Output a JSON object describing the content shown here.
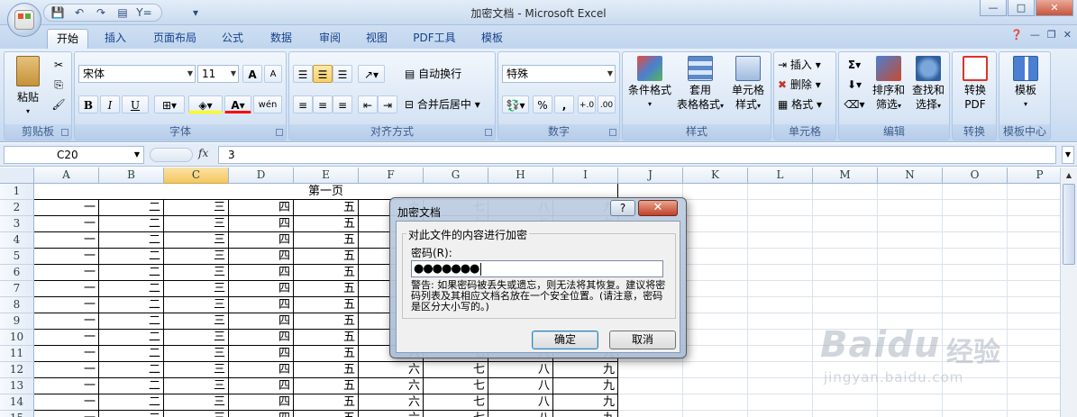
{
  "window": {
    "title": "加密文档 - Microsoft Excel"
  },
  "qat": {
    "save": "💾",
    "undo": "↶",
    "redo": "↷",
    "customize": "▾"
  },
  "tabs": [
    "开始",
    "插入",
    "页面布局",
    "公式",
    "数据",
    "审阅",
    "视图",
    "PDF工具",
    "模板"
  ],
  "active_tab": "开始",
  "ribbon": {
    "clipboard": {
      "label": "剪贴板",
      "paste": "粘贴"
    },
    "font": {
      "label": "字体",
      "font_name": "宋体",
      "font_size": "11",
      "bold": "B",
      "italic": "I",
      "underline": "U",
      "grow": "A",
      "shrink": "A",
      "phonetic": "wén"
    },
    "alignment": {
      "label": "对齐方式",
      "wrap": "自动换行",
      "merge": "合并后居中"
    },
    "number": {
      "label": "数字",
      "format": "特殊",
      "percent": "%",
      "comma": ","
    },
    "styles": {
      "label": "样式",
      "conditional_line1": "条件格式",
      "table_line1": "套用",
      "table_line2": "表格格式",
      "cell_line1": "单元格",
      "cell_line2": "样式"
    },
    "cells": {
      "label": "单元格",
      "insert": "插入",
      "delete": "删除",
      "format": "格式"
    },
    "editing": {
      "label": "编辑",
      "sigma": "Σ",
      "sort_line1": "排序和",
      "sort_line2": "筛选",
      "find_line1": "查找和",
      "find_line2": "选择"
    },
    "convert": {
      "label": "转换",
      "pdf_line1": "转换",
      "pdf_line2": "PDF"
    },
    "template": {
      "label": "模板中心",
      "btn": "模板"
    }
  },
  "formula_bar": {
    "cell_ref": "C20",
    "fx": "fx",
    "value": "3"
  },
  "columns": [
    "A",
    "B",
    "C",
    "D",
    "E",
    "F",
    "G",
    "H",
    "I",
    "J",
    "K",
    "L",
    "M",
    "N",
    "O",
    "P"
  ],
  "selected_column": "C",
  "rows": [
    "1",
    "2",
    "3",
    "4",
    "5",
    "6",
    "7",
    "8",
    "9",
    "10",
    "11",
    "12",
    "13",
    "14",
    "15"
  ],
  "sheet": {
    "title": "第一页",
    "row_values": [
      "一",
      "二",
      "三",
      "四",
      "五",
      "六",
      "七",
      "八",
      "九"
    ],
    "visible_rows_full": [
      "12",
      "13",
      "14"
    ]
  },
  "dialog": {
    "title": "加密文档",
    "help": "?",
    "close": "✕",
    "group_label": "对此文件的内容进行加密",
    "password_label": "密码(R):",
    "password_mask": "●●●●●●●",
    "warning": "警告: 如果密码被丢失或遗忘，则无法将其恢复。建议将密码列表及其相应文档名放在一个安全位置。(请注意，密码是区分大小写的。)",
    "ok": "确定",
    "cancel": "取消"
  },
  "watermark": {
    "brand": "Baidu",
    "brand_cn": "经验",
    "url": "jingyan.baidu.com"
  }
}
